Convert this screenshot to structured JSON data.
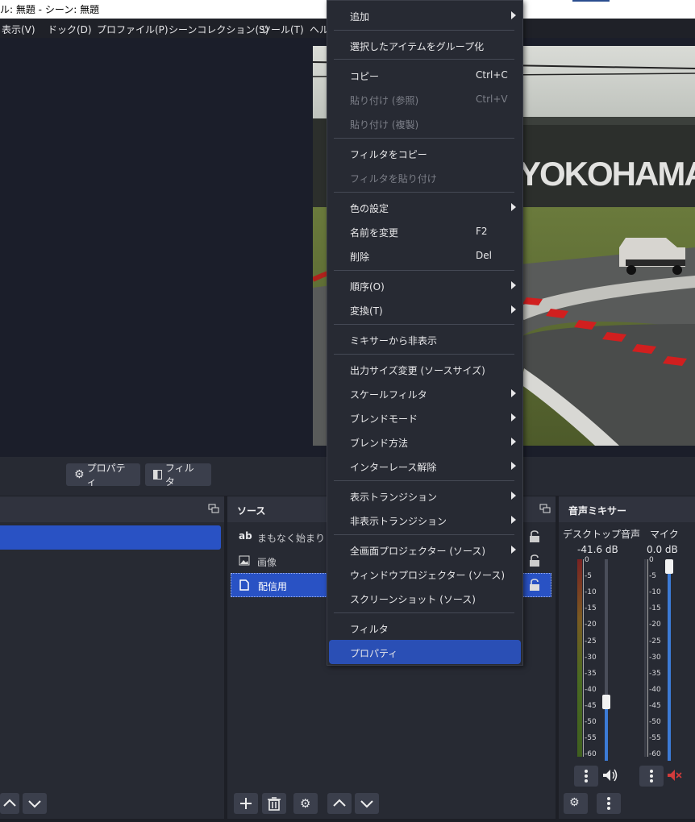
{
  "window": {
    "title": "ル: 無題 - シーン: 無題"
  },
  "menubar": {
    "items": [
      "表示(V)",
      "ドック(D)",
      "プロファイル(P)",
      "シーンコレクション(S)",
      "ツール(T)",
      "ヘル"
    ]
  },
  "toolbar": {
    "properties_label": "プロパティ",
    "filters_label": "フィルタ"
  },
  "sources_dock": {
    "title": "ソース",
    "items": [
      {
        "label": "まもなく始まりま",
        "icon": "text-icon",
        "icon_text": "ab"
      },
      {
        "label": "画像",
        "icon": "image-icon"
      },
      {
        "label": "配信用",
        "icon": "file-icon"
      }
    ]
  },
  "preview": {
    "banner_text": "YOKOHAMA"
  },
  "audio_mixer": {
    "title": "音声ミキサー",
    "channels": [
      {
        "name": "デスクトップ音声",
        "db": "-41.6 dB",
        "muted": false
      },
      {
        "name": "マイク",
        "db": "0.0 dB",
        "muted": true
      }
    ],
    "scale": [
      "0",
      "-5",
      "-10",
      "-15",
      "-20",
      "-25",
      "-30",
      "-35",
      "-40",
      "-45",
      "-50",
      "-55",
      "-60"
    ]
  },
  "context_menu": {
    "items": [
      {
        "label": "追加",
        "submenu": true
      },
      {
        "label": "選択したアイテムをグループ化"
      },
      {
        "label": "コピー",
        "shortcut": "Ctrl+C"
      },
      {
        "label": "貼り付け (参照)",
        "shortcut": "Ctrl+V",
        "disabled": true
      },
      {
        "label": "貼り付け (複製)",
        "disabled": true
      },
      {
        "label": "フィルタをコピー"
      },
      {
        "label": "フィルタを貼り付け",
        "disabled": true
      },
      {
        "label": "色の設定",
        "submenu": true
      },
      {
        "label": "名前を変更",
        "shortcut": "F2"
      },
      {
        "label": "削除",
        "shortcut": "Del"
      },
      {
        "label": "順序(O)",
        "submenu": true
      },
      {
        "label": "変換(T)",
        "submenu": true
      },
      {
        "label": "ミキサーから非表示"
      },
      {
        "label": "出力サイズ変更 (ソースサイズ)"
      },
      {
        "label": "スケールフィルタ",
        "submenu": true
      },
      {
        "label": "ブレンドモード",
        "submenu": true
      },
      {
        "label": "ブレンド方法",
        "submenu": true
      },
      {
        "label": "インターレース解除",
        "submenu": true
      },
      {
        "label": "表示トランジション",
        "submenu": true
      },
      {
        "label": "非表示トランジション",
        "submenu": true
      },
      {
        "label": "全画面プロジェクター (ソース)",
        "submenu": true
      },
      {
        "label": "ウィンドウプロジェクター (ソース)"
      },
      {
        "label": "スクリーンショット (ソース)"
      },
      {
        "label": "フィルタ"
      },
      {
        "label": "プロパティ",
        "active": true
      }
    ]
  },
  "colors": {
    "accent": "#2a4fb5",
    "selection": "#2952c4",
    "mute": "#d33b3b"
  }
}
